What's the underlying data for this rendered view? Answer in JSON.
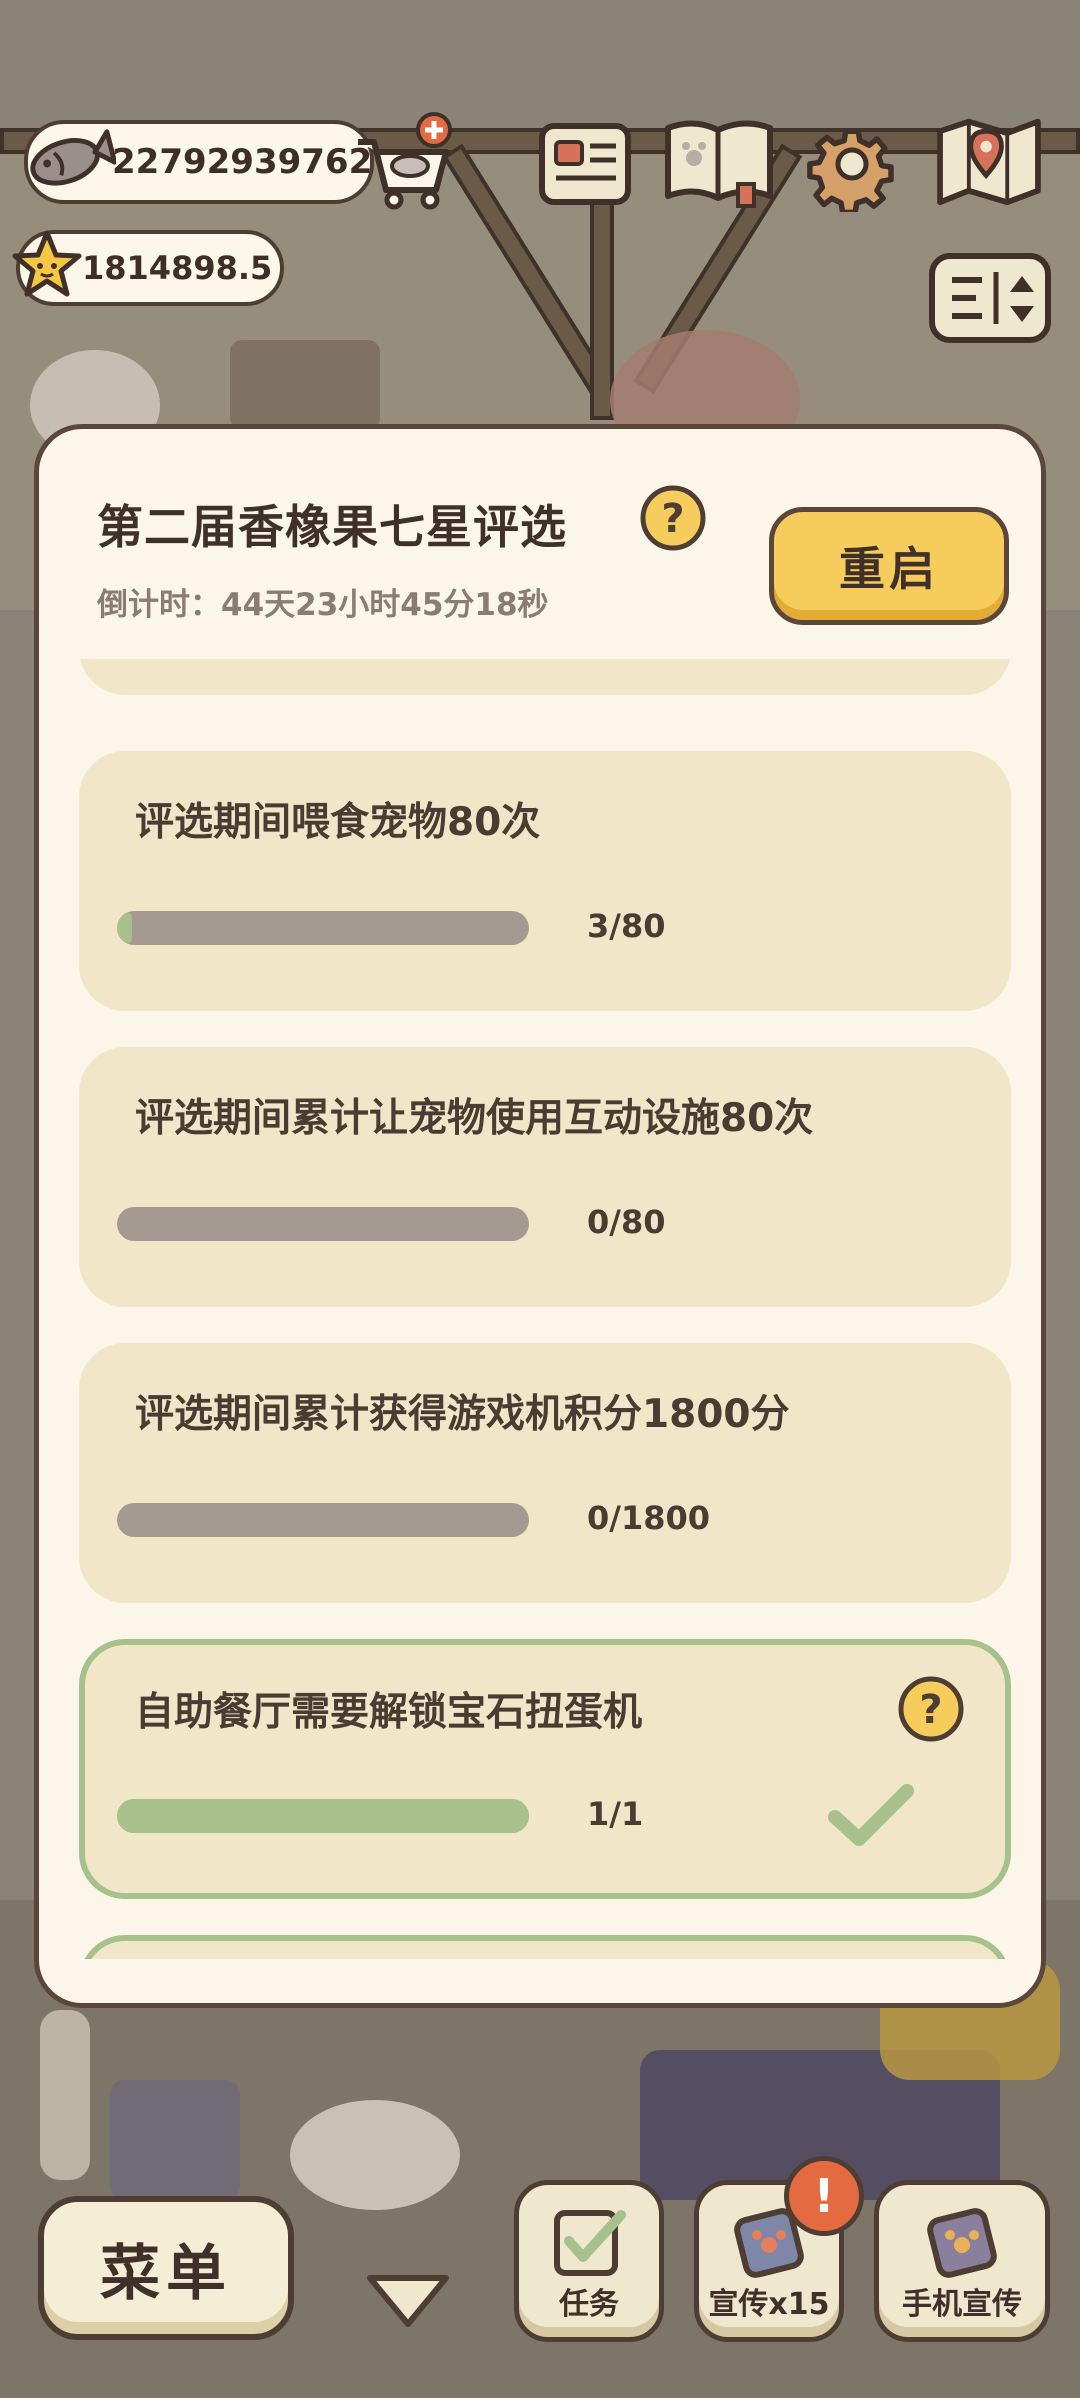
{
  "hud": {
    "fish_currency": "22792939762",
    "star_currency": "1814898.5",
    "icons": [
      "fish-icon",
      "shop-cart-icon",
      "id-card-icon",
      "pet-book-icon",
      "settings-gear-icon",
      "map-icon",
      "sort-toggle-icon",
      "star-coin-icon"
    ]
  },
  "modal": {
    "title": "第二届香橡果七星评选",
    "countdown": "倒计时：44天23小时45分18秒",
    "restart_label": "重启",
    "tasks": [
      {
        "text": "评选期间喂食宠物80次",
        "progress_text": "3/80",
        "progress": 0.0375,
        "done": false
      },
      {
        "text": "评选期间累计让宠物使用互动设施80次",
        "progress_text": "0/80",
        "progress": 0,
        "done": false
      },
      {
        "text": "评选期间累计获得游戏机积分1800分",
        "progress_text": "0/1800",
        "progress": 0,
        "done": false
      },
      {
        "text": "自助餐厅需要解锁宝石扭蛋机",
        "progress_text": "1/1",
        "progress": 1,
        "done": true
      }
    ]
  },
  "dock": {
    "menu_label": "菜单",
    "tasks_label": "任务",
    "promo_label": "宣传x15",
    "phone_promo_label": "手机宣传",
    "alert_badge": "!"
  },
  "colors": {
    "panel_bg": "#fcf6ea",
    "card_bg": "#f2e6c8",
    "accent_yellow": "#f6cd5c",
    "done_green": "#a8c08c",
    "outline_brown": "#5a463b"
  }
}
